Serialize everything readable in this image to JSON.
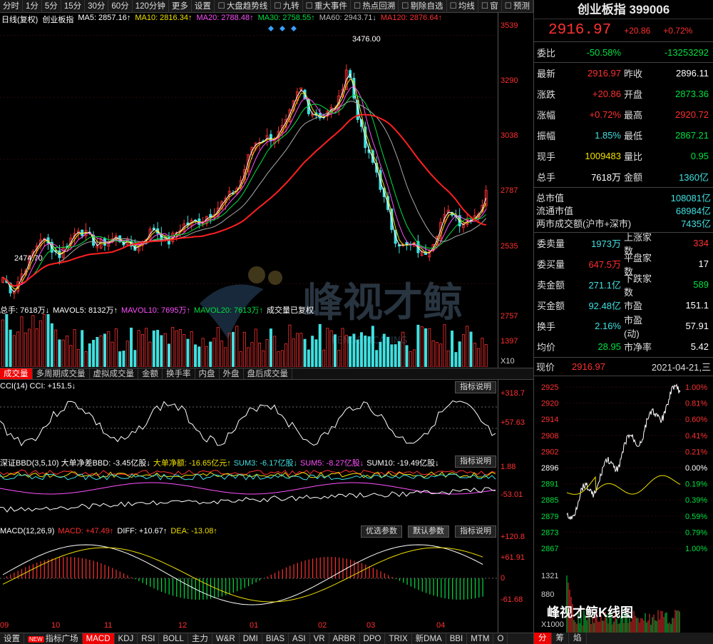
{
  "toolbar": {
    "items": [
      "分时",
      "1分",
      "5分",
      "15分",
      "30分",
      "60分",
      "120分钟",
      "更多",
      "设置"
    ],
    "checks": [
      "大盘趋势线",
      "九转",
      "重大事件",
      "热点回溯",
      "剔除自选",
      "均线",
      "窗",
      "预测"
    ]
  },
  "legend": {
    "title": "日线(复权)",
    "name": "创业板指",
    "ma5": "MA5: 2857.16↑",
    "ma10": "MA10: 2816.34↑",
    "ma20": "MA20: 2788.48↑",
    "ma30": "MA30: 2758.55↑",
    "ma60": "MA60: 2943.71↓",
    "ma120": "MA120: 2876.64↑"
  },
  "price_axis": [
    "3539",
    "3290",
    "3038",
    "2787",
    "2535"
  ],
  "annotations": {
    "high": "3476.00",
    "low": "2474.70"
  },
  "vol": {
    "legend": {
      "total": "总手: 7618万↓",
      "mavol5": "MAVOL5: 8132万↑",
      "mavol10": "MAVOL10: 7695万↑",
      "mavol20": "MAVOL20: 7613万↑",
      "note": "成交量已复权"
    },
    "axis": [
      "2757",
      "1397"
    ],
    "unit": "X10"
  },
  "tabs": [
    "成交量",
    "多周期成交量",
    "虚拟成交量",
    "金额",
    "换手率",
    "内盘",
    "外盘",
    "盘后成交量"
  ],
  "cci": {
    "label": "CCI(14) CCI: +151.5↓",
    "axis": [
      "+318.7",
      "+57.63"
    ],
    "btn": "指标说明"
  },
  "bbd": {
    "label1": "深证BBD(3,5,10) 大单净差BBD: -3.45亿股↓",
    "label2": "大单净额: -16.65亿元↑",
    "label3": "SUM3: -6.17亿股↓",
    "label4": "SUM5: -8.27亿股↓",
    "label5": "SUM10: -19.49亿股↓",
    "axis": [
      "1.88",
      "-53.01"
    ],
    "btn": "指标说明"
  },
  "macd": {
    "label1": "MACD(12,26,9)",
    "label2": "MACD: +47.49↑",
    "label3": "DIFF: +10.67↑",
    "label4": "DEA: -13.08↑",
    "axis": [
      "+120.8",
      "+61.91",
      "0",
      "-61.68"
    ],
    "btn_opt": "优选参数",
    "btn_def": "默认参数",
    "btn": "指标说明"
  },
  "xaxis": [
    "09",
    "10",
    "11",
    "12",
    "01",
    "02",
    "03",
    "04"
  ],
  "bottombar": [
    "设置",
    "指标广场",
    "MACD",
    "KDJ",
    "RSI",
    "BOLL",
    "主力",
    "W&R",
    "DMI",
    "BIAS",
    "ASI",
    "VR",
    "ARBR",
    "DPO",
    "TRIX",
    "新DMA",
    "BBI",
    "MTM",
    "O"
  ],
  "new_tag": "NEW",
  "watermark": "峰视才鲸",
  "watermark_en": "FENGSHICAIJING",
  "quote": {
    "title": "创业板指 399006",
    "price": "2916.97",
    "change": "+20.86",
    "pct": "+0.72%",
    "webi_label": "委比",
    "webi": "-50.58%",
    "wecha": "-13253292",
    "rows": [
      {
        "k": "最新",
        "v": "2916.97",
        "vc": "red",
        "k2": "昨收",
        "v2": "2896.11",
        "v2c": "white"
      },
      {
        "k": "涨跌",
        "v": "+20.86",
        "vc": "red",
        "k2": "开盘",
        "v2": "2873.36",
        "v2c": "green"
      },
      {
        "k": "涨幅",
        "v": "+0.72%",
        "vc": "red",
        "k2": "最高",
        "v2": "2920.72",
        "v2c": "red"
      },
      {
        "k": "振幅",
        "v": "1.85%",
        "vc": "cyan",
        "k2": "最低",
        "v2": "2867.21",
        "v2c": "green"
      },
      {
        "k": "现手",
        "v": "1009483",
        "vc": "yellow",
        "k2": "量比",
        "v2": "0.95",
        "v2c": "green"
      },
      {
        "k": "总手",
        "v": "7618万",
        "vc": "white",
        "k2": "金额",
        "v2": "1360亿",
        "v2c": "cyan"
      }
    ],
    "mkt": [
      {
        "k": "总市值",
        "v": "108081亿"
      },
      {
        "k": "流通市值",
        "v": "68984亿"
      },
      {
        "k": "两市成交额(沪市+深市)",
        "v": "7435亿"
      }
    ],
    "rows2": [
      {
        "k": "委卖量",
        "v": "1973万",
        "vc": "cyan",
        "k2": "上涨家数",
        "v2": "334",
        "v2c": "red"
      },
      {
        "k": "委买量",
        "v": "647.5万",
        "vc": "red",
        "k2": "平盘家数",
        "v2": "17",
        "v2c": "white"
      },
      {
        "k": "卖金额",
        "v": "271.1亿",
        "vc": "cyan",
        "k2": "下跌家数",
        "v2": "589",
        "v2c": "green"
      },
      {
        "k": "买金额",
        "v": "92.48亿",
        "vc": "cyan",
        "k2": "市盈",
        "v2": "151.1",
        "v2c": "white"
      },
      {
        "k": "换手",
        "v": "2.16%",
        "vc": "cyan",
        "k2": "市盈(动)",
        "v2": "57.91",
        "v2c": "white"
      },
      {
        "k": "均价",
        "v": "28.95",
        "vc": "green",
        "k2": "市净率",
        "v2": "5.42",
        "v2c": "white"
      }
    ],
    "now_label": "现价",
    "now_price": "2916.97",
    "date": "2021-04-21,三",
    "mini_left": [
      "2925",
      "2920",
      "2914",
      "2908",
      "2902",
      "2896",
      "2891",
      "2885",
      "2879",
      "2873",
      "2867"
    ],
    "mini_right": [
      "1.00%",
      "0.81%",
      "0.60%",
      "0.41%",
      "0.21%",
      "0.00%",
      "0.19%",
      "0.39%",
      "0.59%",
      "0.79%",
      "1.00%"
    ],
    "mini_vol": [
      "1321",
      "880",
      "X1000"
    ],
    "foot": [
      "分",
      "筹",
      "焰"
    ],
    "wm_caption": "峰视才鲸K线图"
  },
  "colors": {
    "up": "#ff3030",
    "down": "#40e0e0",
    "bg": "#000000",
    "ma120": "#ff2020"
  }
}
